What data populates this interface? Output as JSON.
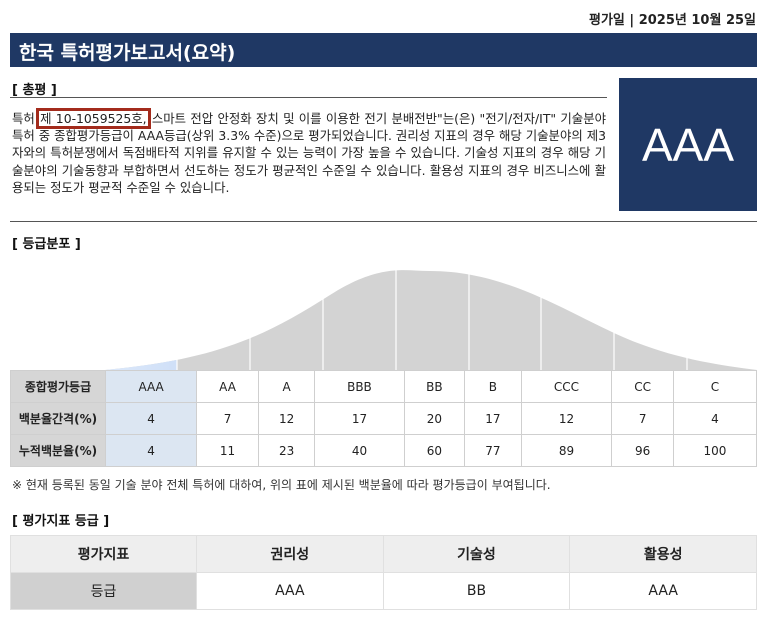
{
  "header": {
    "date": "평가일 | 2025년 10월 25일",
    "title": "한국 특허평가보고서(요약)"
  },
  "summary": {
    "heading": "[ 총평 ]",
    "text_before": "특허 ",
    "highlight": "제 10-1059525호,",
    "text_after": " 스마트 전압 안정화 장치 및 이를 이용한 전기 분배전반\"는(은) \"전기/전자/IT\" 기술분야 특허 중 종합평가등급이 AAA등급(상위 3.3% 수준)으로 평가되었습니다. 권리성 지표의 경우 해당 기술분야의 제3자와의 특허분쟁에서 독점배타적 지위를 유지할 수 있는 능력이 가장 높을 수 있습니다. 기술성 지표의 경우 해당 기술분야의 기술동향과 부합하면서 선도하는 정도가 평균적인 수준일 수 있습니다. 활용성 지표의 경우 비즈니스에 활용되는 정도가 평균적 수준일 수 있습니다.",
    "grade": "AAA"
  },
  "distribution": {
    "heading": "[ 등급분포 ]",
    "row_labels": [
      "종합평가등급",
      "백분율간격(%)",
      "누적백분율(%)"
    ],
    "grades": [
      "AAA",
      "AA",
      "A",
      "BBB",
      "BB",
      "B",
      "CCC",
      "CC",
      "C"
    ],
    "intervals": [
      "4",
      "7",
      "12",
      "17",
      "20",
      "17",
      "12",
      "7",
      "4"
    ],
    "cumulative": [
      "4",
      "11",
      "23",
      "40",
      "60",
      "77",
      "89",
      "96",
      "100"
    ],
    "highlight_grade": "AAA",
    "colors": {
      "curve_fill": "#d3d3d3",
      "highlight_fill": "#7aa7e8"
    },
    "note": "※ 현재 등록된 동일 기술 분야 전체 특허에 대하여, 위의 표에 제시된 백분율에 따라 평가등급이 부여됩니다."
  },
  "indicators": {
    "heading": "[ 평가지표 등급 ]",
    "header": [
      "평가지표",
      "권리성",
      "기술성",
      "활용성"
    ],
    "values": [
      "등급",
      "AAA",
      "BB",
      "AAA"
    ]
  }
}
